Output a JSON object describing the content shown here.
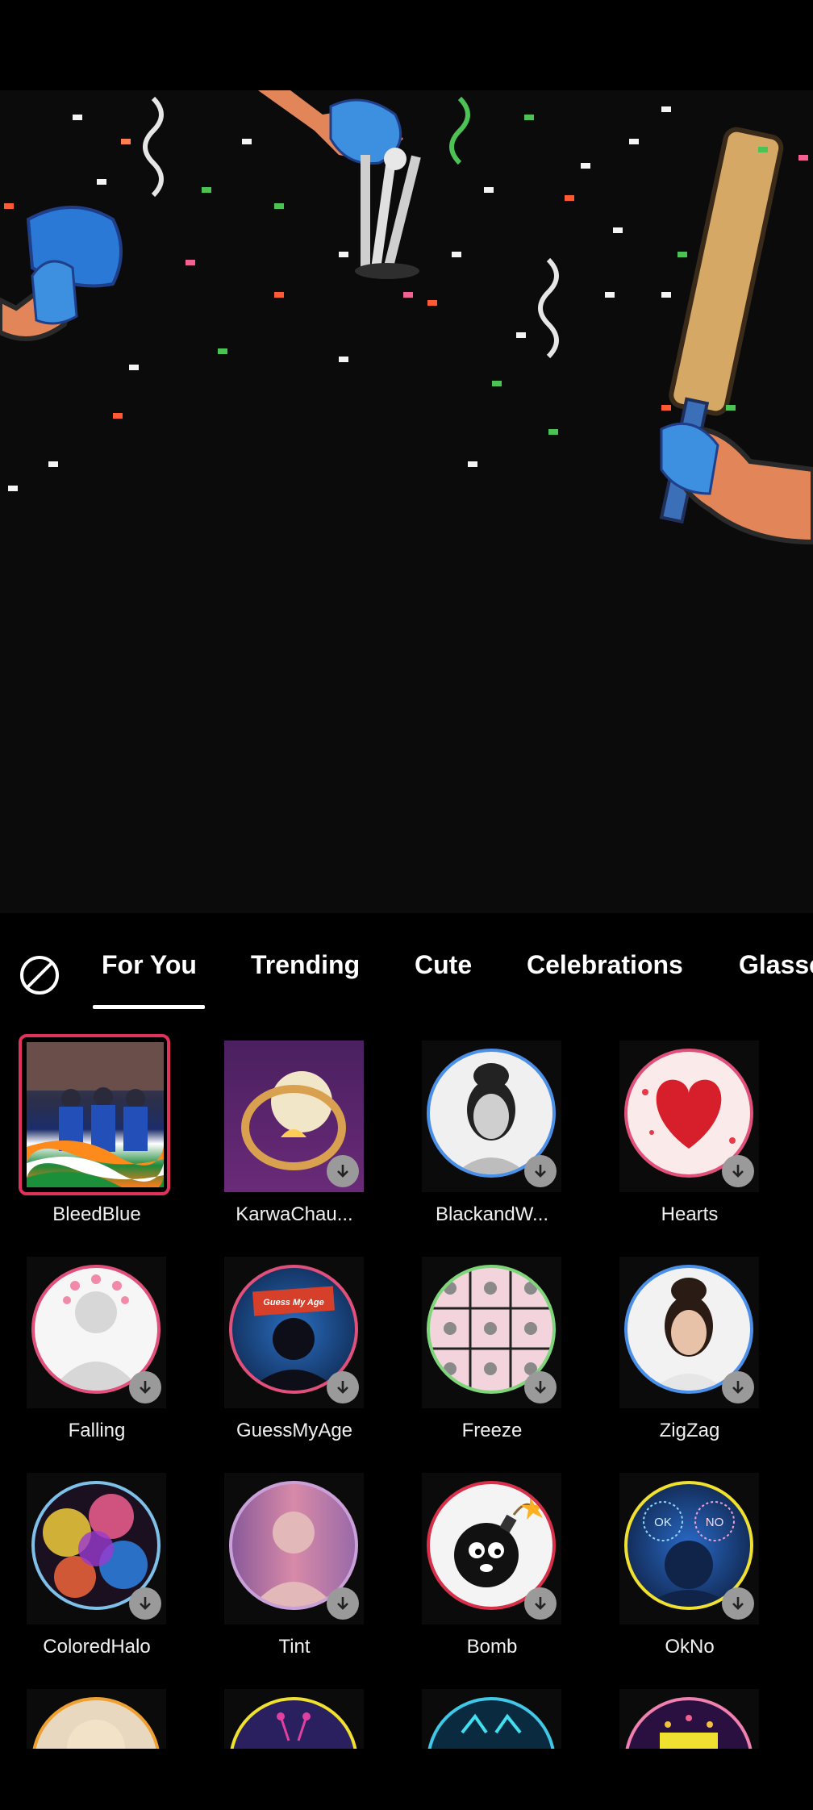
{
  "tabs": {
    "none_label": "",
    "items": [
      "For You",
      "Trending",
      "Cute",
      "Celebrations",
      "Glasse"
    ]
  },
  "effects": [
    {
      "name": "BleedBlue",
      "selected": true
    },
    {
      "name": "KarwaChau...",
      "selected": false
    },
    {
      "name": "BlackandW...",
      "selected": false
    },
    {
      "name": "Hearts",
      "selected": false
    },
    {
      "name": "Falling",
      "selected": false
    },
    {
      "name": "GuessMyAge",
      "selected": false,
      "thumb_text": "Guess My Age"
    },
    {
      "name": "Freeze",
      "selected": false
    },
    {
      "name": "ZigZag",
      "selected": false
    },
    {
      "name": "ColoredHalo",
      "selected": false
    },
    {
      "name": "Tint",
      "selected": false
    },
    {
      "name": "Bomb",
      "selected": false
    },
    {
      "name": "OkNo",
      "selected": false,
      "thumb_text_left": "OK",
      "thumb_text_right": "NO"
    }
  ],
  "colors": {
    "selected_border": "#e0325b",
    "background": "#000000",
    "download_badge": "#9a9a9a"
  }
}
